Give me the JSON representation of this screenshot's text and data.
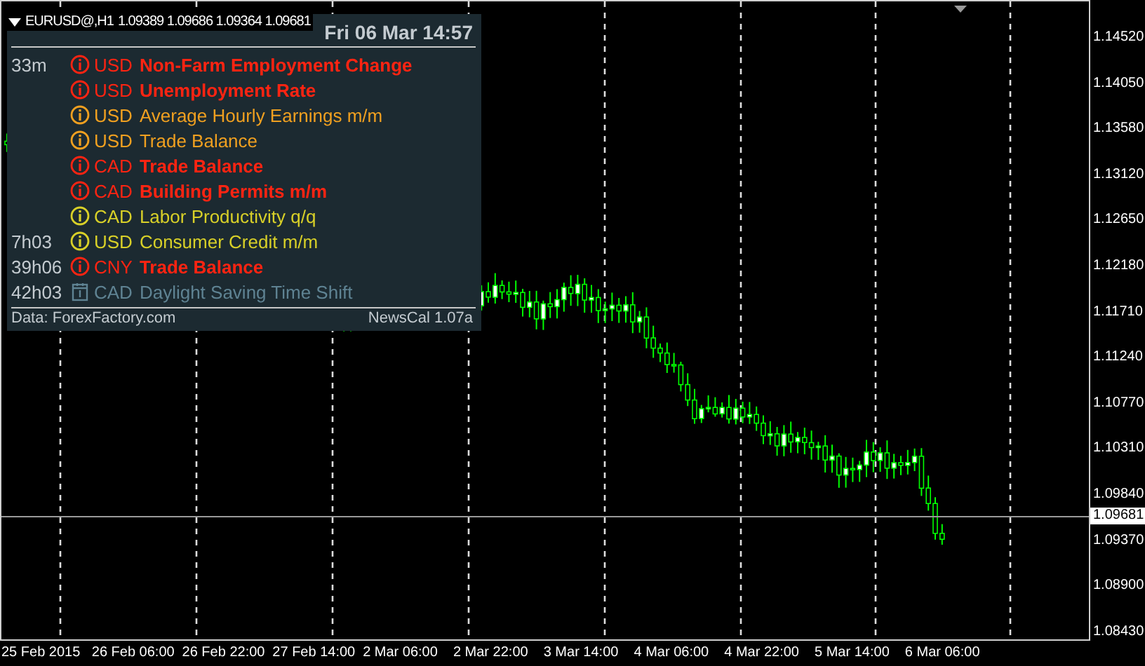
{
  "symbol_label": {
    "symbol": "EURUSD@,H1",
    "quote": "1.09389 1.09686 1.09364 1.09681"
  },
  "calendar": {
    "datetime": "Fri 06 Mar 14:57",
    "events": [
      {
        "time": "33m",
        "kind": "high",
        "currency": "USD",
        "title": "Non-Farm Employment Change"
      },
      {
        "kind": "high",
        "currency": "USD",
        "title": "Unemployment Rate"
      },
      {
        "kind": "medium",
        "currency": "USD",
        "title": "Average Hourly Earnings m/m"
      },
      {
        "kind": "medium",
        "currency": "USD",
        "title": "Trade Balance"
      },
      {
        "kind": "high",
        "currency": "CAD",
        "title": "Trade Balance"
      },
      {
        "kind": "high",
        "currency": "CAD",
        "title": "Building Permits m/m"
      },
      {
        "kind": "low",
        "currency": "CAD",
        "title": "Labor Productivity q/q"
      },
      {
        "time": "7h03",
        "kind": "low",
        "currency": "USD",
        "title": "Consumer Credit m/m"
      },
      {
        "time": "39h06",
        "kind": "high",
        "currency": "CNY",
        "title": "Trade Balance"
      },
      {
        "time": "42h03",
        "kind": "holiday",
        "currency": "CAD",
        "title": "Daylight Saving Time Shift"
      }
    ],
    "source": "Data: ForexFactory.com",
    "version": "NewsCal 1.07a"
  },
  "price_axis": {
    "labels": [
      "1.14520",
      "1.14050",
      "1.13580",
      "1.13120",
      "1.12650",
      "1.12180",
      "1.11710",
      "1.11240",
      "1.10770",
      "1.10310",
      "1.09840",
      "1.09370",
      "1.08900",
      "1.08430"
    ],
    "current_price": "1.09681"
  },
  "time_axis": {
    "labels": [
      "25 Feb 2015",
      "26 Feb 06:00",
      "26 Feb 22:00",
      "27 Feb 14:00",
      "2 Mar 06:00",
      "2 Mar 22:00",
      "3 Mar 14:00",
      "4 Mar 06:00",
      "4 Mar 22:00",
      "5 Mar 14:00",
      "6 Mar 06:00"
    ]
  }
}
